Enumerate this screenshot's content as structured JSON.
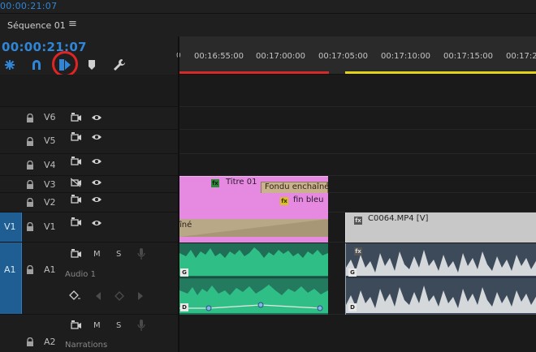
{
  "app": {
    "top_timecode": "00:00:21:07",
    "sequence_tab": "Séquence 01",
    "menu_glyph": "≡",
    "playhead_timecode": "00:00:21:07"
  },
  "tools": [
    {
      "name": "snap-icon"
    },
    {
      "name": "linked-selection-icon"
    },
    {
      "name": "add-marker-icon"
    },
    {
      "name": "marker-icon"
    },
    {
      "name": "wrench-icon"
    }
  ],
  "ruler": {
    "start_label": "0",
    "ticks": [
      "00:16:55:00",
      "00:17:00:00",
      "00:17:05:00",
      "00:17:10:00",
      "00:17:15:00",
      "00:17:2"
    ]
  },
  "tracks": {
    "v6": {
      "label": "V6"
    },
    "v5": {
      "label": "V5"
    },
    "v4": {
      "label": "V4"
    },
    "v3": {
      "label": "V3"
    },
    "v2": {
      "label": "V2"
    },
    "v1": {
      "label": "V1",
      "source": "V1"
    },
    "a1": {
      "label": "A1",
      "source": "A1",
      "m": "M",
      "s": "S",
      "name": "Audio 1"
    },
    "a2": {
      "label": "A2",
      "m": "M",
      "s": "S",
      "name": "Narrations"
    }
  },
  "clips": {
    "titre": {
      "label": "Titre 01",
      "fx": "fx"
    },
    "fondu": {
      "label": "Fondu enchaîné"
    },
    "finbleu": {
      "label": "fin bleu",
      "fx": "fx"
    },
    "v1_left": {
      "label": "îné"
    },
    "c0064": {
      "label": "C0064.MP4 [V]",
      "fx": "fx"
    },
    "a1_left_top_badge": "G",
    "a1_left_bottom_badge": "D",
    "a1_right_badge": "fx",
    "a1_right_top_badge": "G",
    "a1_right_bottom_badge": "D"
  },
  "colors": {
    "accent_blue": "#2f86d8",
    "title_pink": "#e58ae0",
    "audio_green": "#2fbf86",
    "video_tan": "#b9a887",
    "video_gray": "#c8c8c8",
    "playhead_red": "#d62a2a",
    "workarea_yellow": "#e3d317",
    "highlight_ring": "#e02424"
  }
}
